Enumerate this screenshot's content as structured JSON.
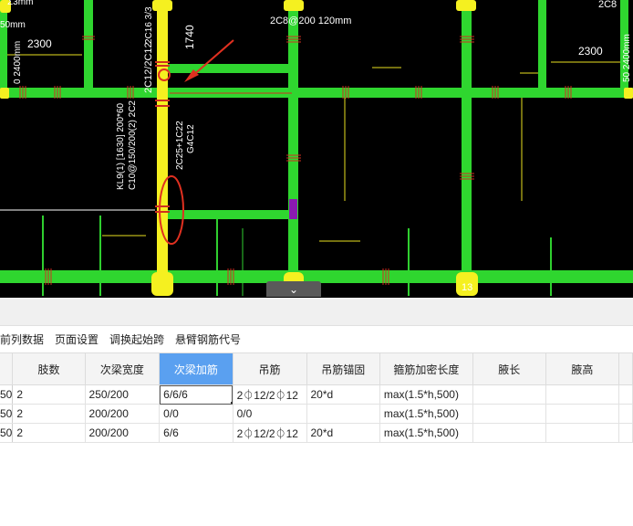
{
  "drawing": {
    "labels": {
      "top_mid": "2C8@200 120mm",
      "left_2300": "2300",
      "left_2400": "0 2400mm",
      "left_top": "Σ3mm",
      "left_mm": "50mm",
      "right_top": "2C8",
      "right_2300": "2300",
      "right_vertical": "50 2400mm",
      "dim_1740": "1740",
      "beam_vertical_a": "2C12/2C12",
      "beam_vertical_b": "2C16 3/3",
      "beam_spec_1": "KL9(1) [1630] 200*60",
      "beam_spec_2": "C10@150/200(2) 2C2",
      "beam_spec_3": "2C25+1C22",
      "beam_spec_4": "G4C12",
      "bottom_num": "13",
      "top_num_right": "2"
    },
    "collapse_icon": "chevron-down-icon"
  },
  "toolbar": {
    "items": [
      "前列数据",
      "页面设置",
      "调换起始跨",
      "悬臂钢筋代号"
    ]
  },
  "table": {
    "columns": [
      "",
      "肢数",
      "次梁宽度",
      "次梁加筋",
      "吊筋",
      "吊筋锚固",
      "箍筋加密长度",
      "腋长",
      "腋高"
    ],
    "selected_column": 3,
    "rows": [
      [
        "50",
        "2",
        "250/200",
        "6/6/6",
        "2⏀12/2⏀12",
        "20*d",
        "max(1.5*h,500)",
        "",
        ""
      ],
      [
        "50",
        "2",
        "200/200",
        "0/0",
        "0/0",
        "",
        "max(1.5*h,500)",
        "",
        ""
      ],
      [
        "50",
        "2",
        "200/200",
        "6/6",
        "2⏀12/2⏀12",
        "20*d",
        "max(1.5*h,500)",
        "",
        ""
      ]
    ]
  }
}
